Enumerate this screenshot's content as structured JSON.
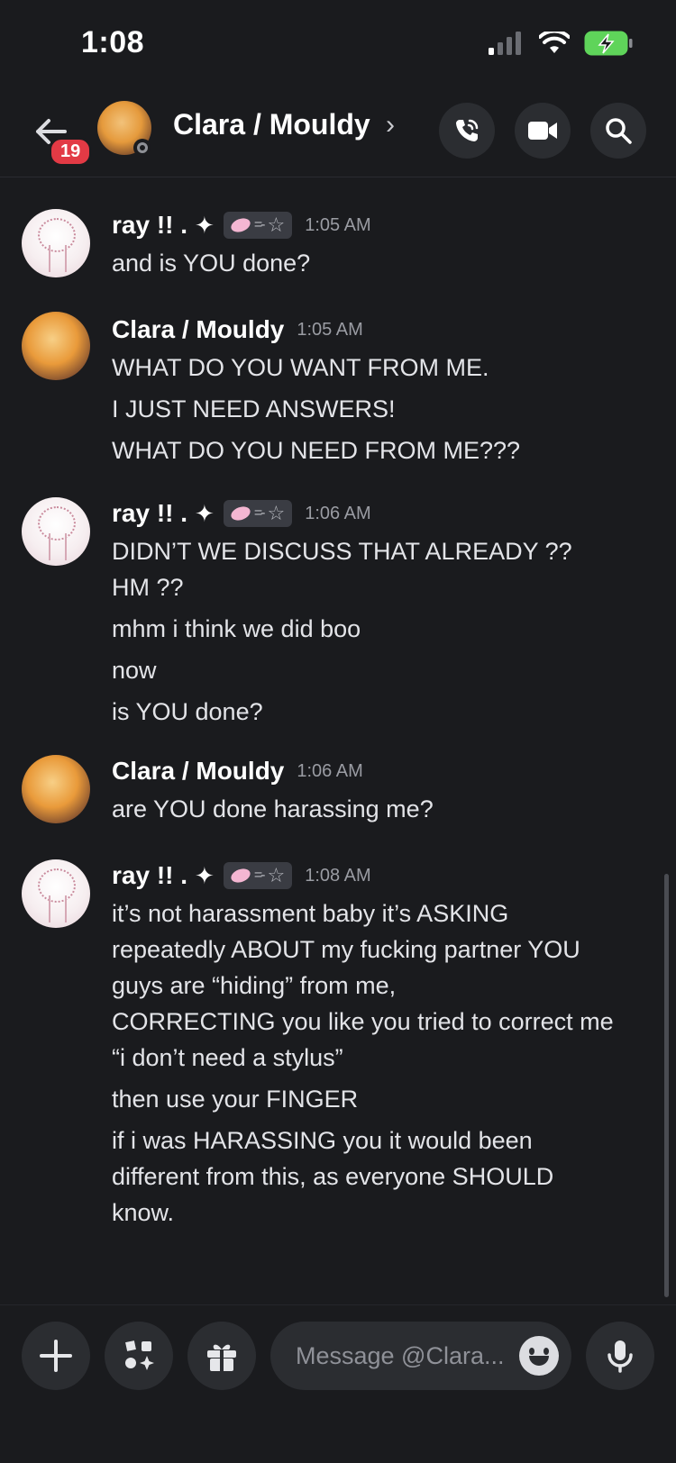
{
  "status": {
    "time": "1:08"
  },
  "header": {
    "unread_count": "19",
    "title": "Clara / Mouldy",
    "chevron": "›"
  },
  "messages": [
    {
      "author": "ray !! .",
      "sparkle": "✦",
      "timestamp": "1:05 AM",
      "lines": [
        "and is YOU done?"
      ]
    },
    {
      "author": "Clara / Mouldy",
      "timestamp": "1:05 AM",
      "lines": [
        "WHAT DO YOU WANT FROM ME.",
        "I JUST NEED ANSWERS!",
        "WHAT DO YOU NEED FROM ME???"
      ]
    },
    {
      "author": "ray !! .",
      "sparkle": "✦",
      "timestamp": "1:06 AM",
      "lines": [
        "DIDN’T WE DISCUSS THAT ALREADY ??",
        "HM ??",
        "mhm i think we did boo",
        "now",
        "is YOU done?"
      ]
    },
    {
      "author": "Clara / Mouldy",
      "timestamp": "1:06 AM",
      "lines": [
        "are YOU done harassing me?"
      ]
    },
    {
      "author": "ray !! .",
      "sparkle": "✦",
      "timestamp": "1:08 AM",
      "lines": [
        "it’s not harassment baby it’s ASKING",
        "repeatedly ABOUT my fucking partner YOU",
        "guys are “hiding” from me,",
        "CORRECTING you like you tried to correct me",
        "“i don’t need a stylus”",
        "then use your FINGER",
        "if i was HARASSING you it would been",
        "different from this, as everyone SHOULD",
        "know."
      ]
    }
  ],
  "composer": {
    "placeholder": "Message @Clara..."
  },
  "colors": {
    "background": "#1a1b1e",
    "badge": "#e23a45",
    "battery": "#5fd45a",
    "button": "#2b2d31"
  },
  "icons": [
    "back-arrow-icon",
    "phone-call-icon",
    "video-camera-icon",
    "search-icon",
    "plus-icon",
    "apps-icon",
    "gift-icon",
    "emoji-icon",
    "microphone-icon"
  ]
}
